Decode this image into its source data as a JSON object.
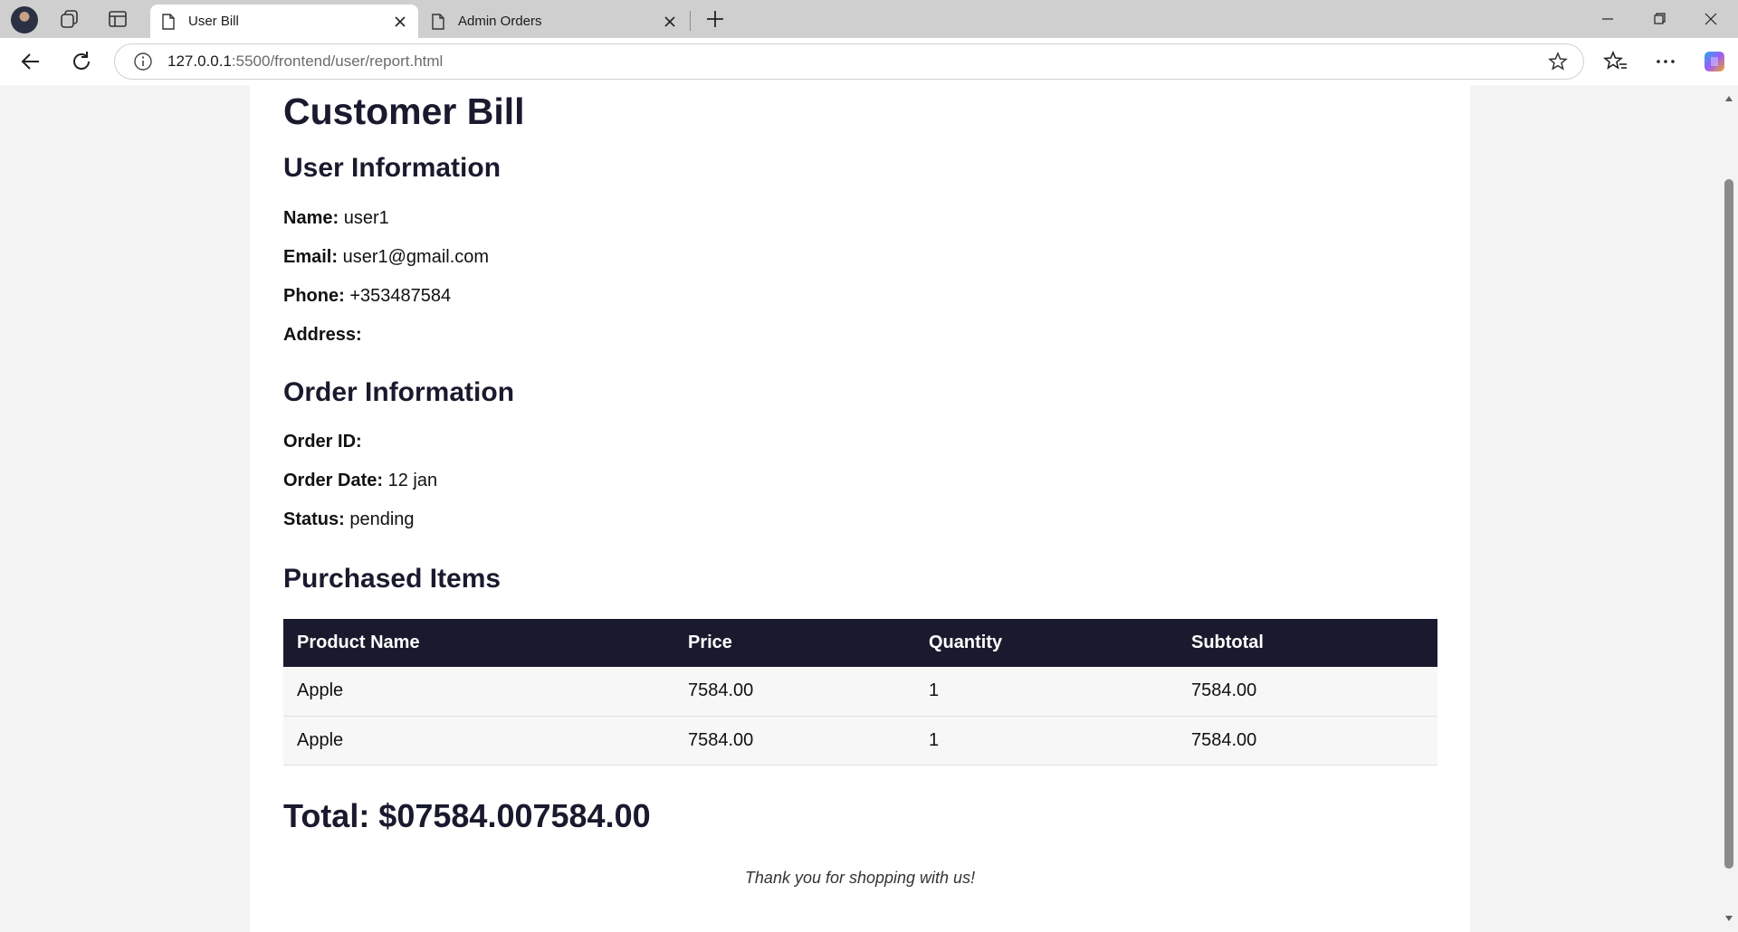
{
  "browser": {
    "tabs": [
      {
        "title": "User Bill",
        "active": true
      },
      {
        "title": "Admin Orders",
        "active": false
      }
    ],
    "url_host": "127.0.0.1",
    "url_path": ":5500/frontend/user/report.html"
  },
  "bill": {
    "title": "Customer Bill",
    "user_section_title": "User Information",
    "name_label": "Name:",
    "name_value": "user1",
    "email_label": "Email:",
    "email_value": "user1@gmail.com",
    "phone_label": "Phone:",
    "phone_value": "+353487584",
    "address_label": "Address:",
    "address_value": "",
    "order_section_title": "Order Information",
    "order_id_label": "Order ID:",
    "order_id_value": "",
    "order_date_label": "Order Date:",
    "order_date_value": "12 jan",
    "status_label": "Status:",
    "status_value": "pending",
    "items_section_title": "Purchased Items",
    "columns": [
      "Product Name",
      "Price",
      "Quantity",
      "Subtotal"
    ],
    "items": [
      {
        "name": "Apple",
        "price": "7584.00",
        "quantity": "1",
        "subtotal": "7584.00"
      },
      {
        "name": "Apple",
        "price": "7584.00",
        "quantity": "1",
        "subtotal": "7584.00"
      }
    ],
    "total": "Total: $07584.007584.00",
    "thanks": "Thank you for shopping with us!"
  },
  "colors": {
    "accent": "#1a1a2e",
    "row_bg": "#f7f7f7"
  }
}
